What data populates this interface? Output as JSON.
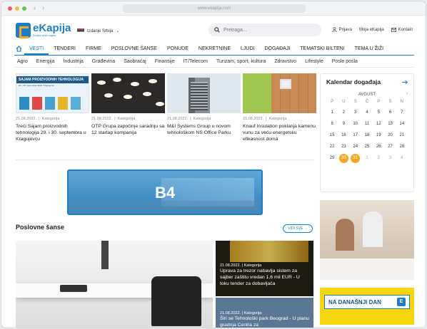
{
  "browser": {
    "url": "www.ekapija.com"
  },
  "header": {
    "logo_name": "eKapija",
    "logo_tagline": "Svaka vesti zapisi",
    "edition": "Izdanje Srbija",
    "search_placeholder": "Pretraga...",
    "links": [
      "Prijava",
      "Moja eKapija",
      "Kontakt"
    ]
  },
  "main_nav": [
    "VESTI",
    "TENDERI",
    "FIRME",
    "POSLOVNE ŠANSE",
    "PONUDE",
    "NEKRETNINE",
    "LJUDI",
    "DOGAĐAJI",
    "TEMATSKI BILTENI",
    "TEMA U ŽIŽI"
  ],
  "sub_nav": [
    "Agro",
    "Energija",
    "Industrija",
    "Građevina",
    "Saobraćaj",
    "Finansije",
    "IT/Telecom",
    "Turizam, sport, kultura",
    "Zdravstvo",
    "Lifestyle",
    "Posle posla"
  ],
  "news": [
    {
      "date": "21.08.2022.",
      "category": "Kategorija",
      "title": "Treći Sajam proizvodnih tehnologija 29. i 30. septembra u Kragujevcu",
      "thumb_label": "SAJAM PROIZVODNIH TEHNOLOGIJA",
      "thumb_sub": "29. i 30. septembar 2022. Kragujevac"
    },
    {
      "date": "21.08.2022.",
      "category": "Kategorija",
      "title": "OTP Grupa započinje saradnju sa 12 startap kompanija"
    },
    {
      "date": "21.08.2022.",
      "category": "Kategorija",
      "title": "M&I Systems Group u novom tehnološkom NS Office Parku"
    },
    {
      "date": "21.08.2022.",
      "category": "Kategorija",
      "title": "Knauf Insulation poklanja kamenu vunu za veću energetsku efikasnost doma"
    }
  ],
  "banner": {
    "label": "B4"
  },
  "opportunities": {
    "title": "Poslovne šanse",
    "see_all": "VIDI SVE",
    "side_items": [
      {
        "date": "21.08.2022.",
        "category": "Kategorija",
        "title": "Uprava za trezor nabavlja sistem za sajber zaštitu vredan 1,6 mil EUR - U toku tender za dobavljača"
      },
      {
        "date": "21.08.2022.",
        "category": "Kategorija",
        "title": "Širi se Tehnološki park Beograd - U planu gradnja Centra za"
      }
    ]
  },
  "calendar": {
    "title": "Kalendar događaja",
    "month": "AVGUST",
    "weekdays": [
      "P",
      "U",
      "S",
      "Č",
      "P",
      "S",
      "N"
    ],
    "days": [
      [
        "1",
        "2",
        "3",
        "4",
        "5",
        "6",
        "7"
      ],
      [
        "8",
        "9",
        "10",
        "11",
        "12",
        "13",
        "14"
      ],
      [
        "15",
        "16",
        "17",
        "18",
        "19",
        "20",
        "21"
      ],
      [
        "22",
        "23",
        "24",
        "25",
        "26",
        "27",
        "28"
      ],
      [
        "29",
        "30",
        "31",
        "1",
        "2",
        "3",
        "4"
      ]
    ],
    "highlighted": [
      "30",
      "31"
    ]
  },
  "ad_bottom": {
    "text": "NA DANAŠNJI DAN",
    "mark": "E"
  },
  "colors": {
    "brand": "#1c7fc6",
    "accent": "#f5a623"
  }
}
